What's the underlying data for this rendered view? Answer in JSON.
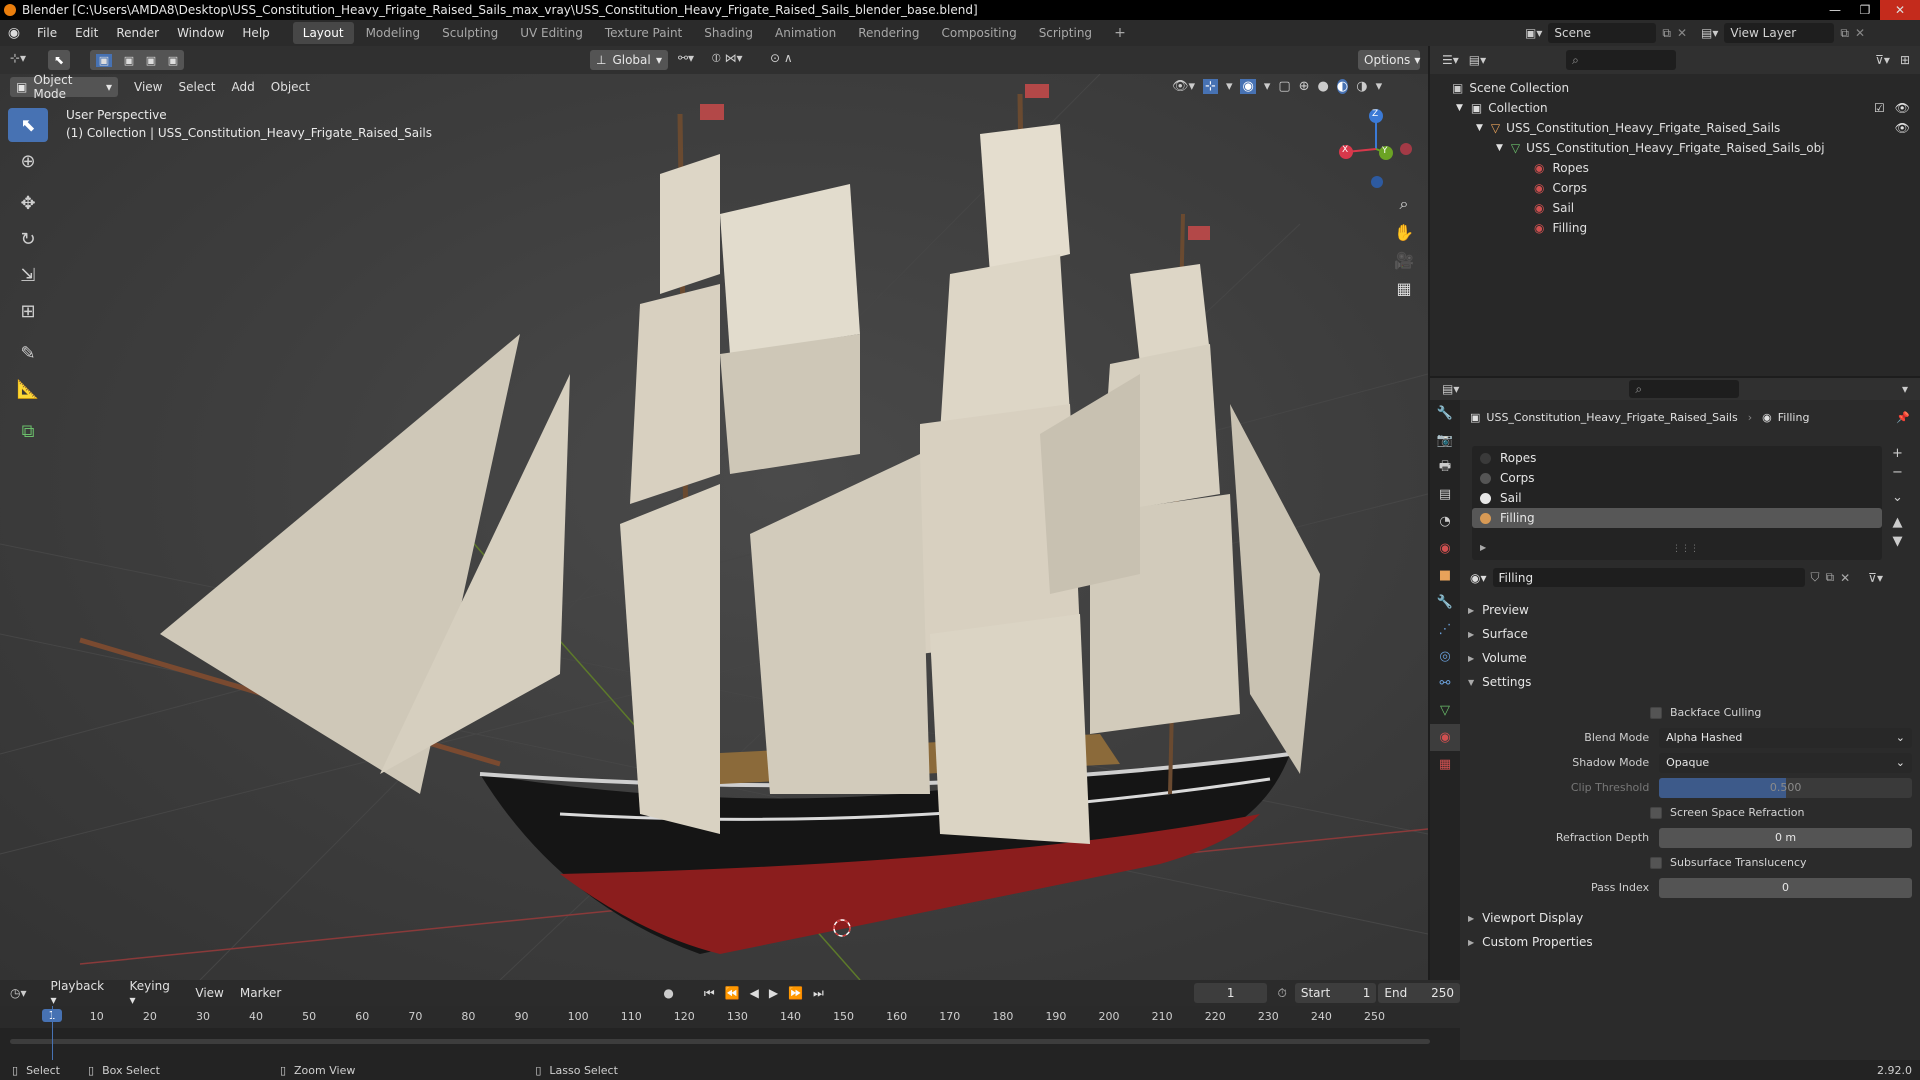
{
  "window": {
    "title": "Blender [C:\\Users\\AMDA8\\Desktop\\USS_Constitution_Heavy_Frigate_Raised_Sails_max_vray\\USS_Constitution_Heavy_Frigate_Raised_Sails_blender_base.blend]",
    "controls": [
      "—",
      "❐",
      "✕"
    ]
  },
  "menu": [
    "File",
    "Edit",
    "Render",
    "Window",
    "Help"
  ],
  "workspaces": [
    "Layout",
    "Modeling",
    "Sculpting",
    "UV Editing",
    "Texture Paint",
    "Shading",
    "Animation",
    "Rendering",
    "Compositing",
    "Scripting"
  ],
  "active_workspace": "Layout",
  "scene": {
    "label": "Scene",
    "view_layer": "View Layer"
  },
  "tool_header": {
    "orientation": "Global",
    "options": "Options"
  },
  "viewport_header": {
    "mode": "Object Mode",
    "menus": [
      "View",
      "Select",
      "Add",
      "Object"
    ]
  },
  "viewport": {
    "perspective": "User Perspective",
    "collection_info": "(1) Collection | USS_Constitution_Heavy_Frigate_Raised_Sails",
    "gizmo": {
      "x": "X",
      "y": "Y",
      "z": "Z"
    }
  },
  "tools": [
    "select-box",
    "cursor",
    "move",
    "rotate",
    "scale",
    "transform",
    "annotate",
    "measure",
    "add-cube"
  ],
  "outliner": {
    "root": "Scene Collection",
    "collection": "Collection",
    "object": "USS_Constitution_Heavy_Frigate_Raised_Sails",
    "mesh": "USS_Constitution_Heavy_Frigate_Raised_Sails_obj",
    "materials": [
      "Ropes",
      "Corps",
      "Sail",
      "Filling"
    ]
  },
  "properties": {
    "breadcrumb_object": "USS_Constitution_Heavy_Frigate_Raised_Sails",
    "breadcrumb_material": "Filling",
    "slots": [
      {
        "name": "Ropes",
        "color": "#3a3a3a"
      },
      {
        "name": "Corps",
        "color": "#4a4a4a"
      },
      {
        "name": "Sail",
        "color": "#e8e8e8"
      },
      {
        "name": "Filling",
        "color": "#d89a55"
      }
    ],
    "selected_slot": "Filling",
    "material_name": "Filling",
    "panels": [
      "Preview",
      "Surface",
      "Volume",
      "Settings"
    ],
    "settings": {
      "backface_culling": "Backface Culling",
      "blend_mode_label": "Blend Mode",
      "blend_mode": "Alpha Hashed",
      "shadow_mode_label": "Shadow Mode",
      "shadow_mode": "Opaque",
      "clip_threshold_label": "Clip Threshold",
      "clip_threshold": "0.500",
      "clip_threshold_fraction": 0.5,
      "ssr": "Screen Space Refraction",
      "refraction_depth_label": "Refraction Depth",
      "refraction_depth": "0 m",
      "sss": "Subsurface Translucency",
      "pass_index_label": "Pass Index",
      "pass_index": "0"
    },
    "bottom_panels": [
      "Viewport Display",
      "Custom Properties"
    ]
  },
  "timeline": {
    "menus": [
      "Playback",
      "Keying",
      "View",
      "Marker"
    ],
    "current_frame": "1",
    "start_label": "Start",
    "start": "1",
    "end_label": "End",
    "end": "250",
    "ticks": [
      "1",
      "10",
      "20",
      "30",
      "40",
      "50",
      "60",
      "70",
      "80",
      "90",
      "100",
      "110",
      "120",
      "130",
      "140",
      "150",
      "160",
      "170",
      "180",
      "190",
      "200",
      "210",
      "220",
      "230",
      "240",
      "250"
    ]
  },
  "statusbar": {
    "items": [
      "Select",
      "Box Select",
      "Zoom View",
      "Lasso Select"
    ],
    "version": "2.92.0"
  }
}
